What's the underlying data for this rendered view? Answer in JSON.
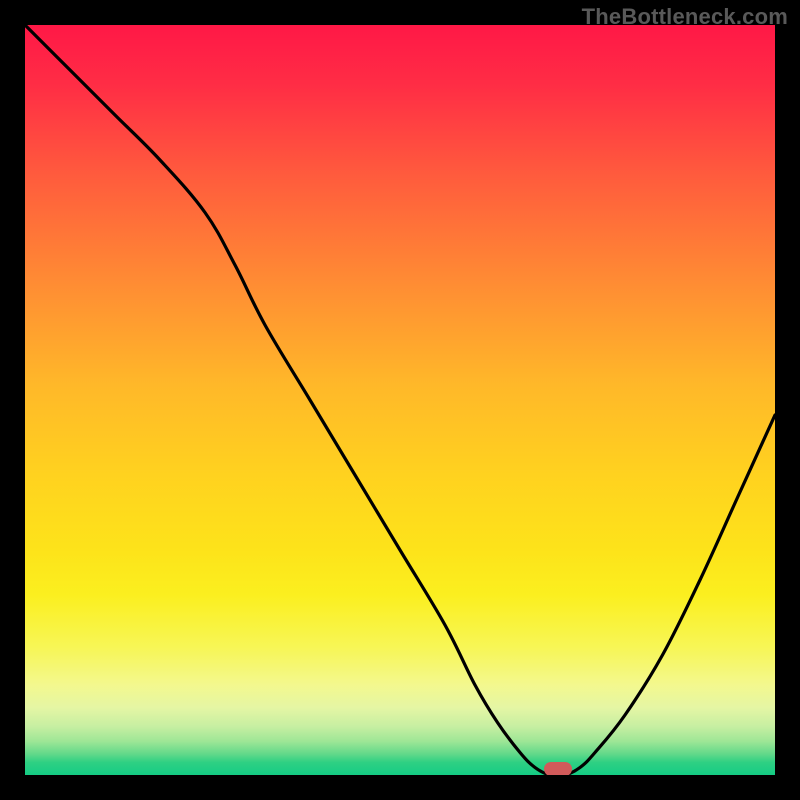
{
  "watermark": "TheBottleneck.com",
  "colors": {
    "frame_bg": "#000000",
    "curve": "#000000",
    "marker": "#d15a5a",
    "gradient_top": "#ff1846",
    "gradient_bottom": "#14cc84"
  },
  "chart_data": {
    "type": "line",
    "title": "",
    "xlabel": "",
    "ylabel": "",
    "xlim": [
      0,
      100
    ],
    "ylim": [
      0,
      100
    ],
    "x": [
      0,
      6,
      12,
      18,
      24,
      28,
      32,
      38,
      44,
      50,
      56,
      60,
      63,
      66,
      68,
      70,
      72,
      74,
      76,
      80,
      85,
      90,
      95,
      100
    ],
    "values": [
      100,
      94,
      88,
      82,
      75,
      68,
      60,
      50,
      40,
      30,
      20,
      12,
      7,
      3,
      1,
      0,
      0,
      1,
      3,
      8,
      16,
      26,
      37,
      48
    ],
    "marker": {
      "x": 71,
      "y": 0
    },
    "grid": false,
    "legend": false
  }
}
